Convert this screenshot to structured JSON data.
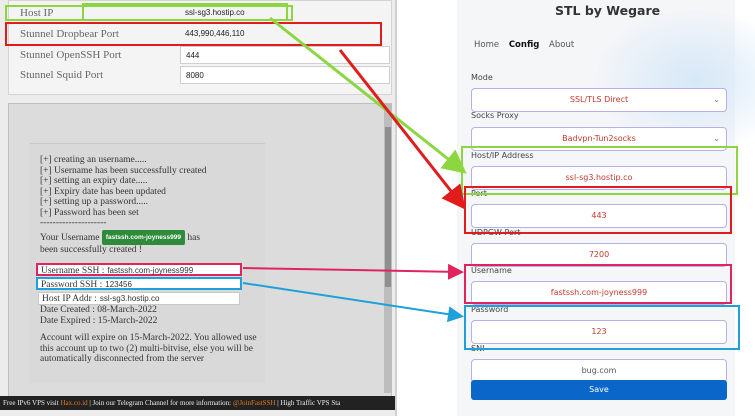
{
  "server_info": {
    "rows": [
      {
        "key": "Host IP",
        "value": "ssl-sg3.hostip.co"
      },
      {
        "key": "Stunnel Dropbear Port",
        "value": "443,990,446,110"
      },
      {
        "key": "Stunnel OpenSSH Port",
        "value": "444"
      },
      {
        "key": "Stunnel Squid Port",
        "value": "8080"
      }
    ]
  },
  "account_log": {
    "lines": [
      "[+] creating an username.....",
      "[+] Username has been successfully created",
      "[+] setting an expiry date.....",
      "[+] Expiry date has been updated",
      "[+] setting up a password.....",
      "[+] Password has been set",
      "---------------------"
    ],
    "username_prefix": "Your Username",
    "username_badge": "fastssh.com-joyness999",
    "username_suffix": "has been successfully created !",
    "username_label": "Username SSH :",
    "username_value": "fastssh.com-joyness999",
    "password_label": "Password SSH :",
    "password_value": "123456",
    "host_label": "Host IP Addr :",
    "host_value": "ssl-sg3.hostip.co",
    "date_created": "Date Created : 08-March-2022",
    "date_expired": "Date Expired : 15-March-2022",
    "note": "Account will expire on 15-March-2022. You allowed use this account up to two (2) multi-bitvise, else you will be automatically disconnected from the server"
  },
  "ticker": {
    "prefix": "Free IPv6 VPS visit",
    "link1": "Hax.co.id",
    "middle": "| Join our Telegram Channel for more information:",
    "link2": "@JoinFastSSH",
    "suffix": "| High Traffic VPS Sta"
  },
  "app": {
    "title": "STL by Wegare",
    "nav": [
      "Home",
      "Config",
      "About"
    ],
    "active_tab": "Config",
    "mode_label": "Mode",
    "mode_value": "SSL/TLS Direct",
    "socks_label": "Socks Proxy",
    "socks_value": "Badvpn-Tun2socks",
    "host_label": "Host/IP Address",
    "host_value": "ssl-sg3.hostip.co",
    "port_label": "Port",
    "port_value": "443",
    "udpgw_label": "UDPGW Port",
    "udpgw_value": "7200",
    "user_label": "Username",
    "user_value": "fastssh.com-joyness999",
    "pass_label": "Password",
    "pass_value": "123",
    "sni_label": "SNI",
    "sni_value": "bug.com",
    "save_label": "Save"
  },
  "colors": {
    "green_highlight": "#8cd642",
    "red_highlight": "#e01c1c",
    "pink_highlight": "#e0245e",
    "blue_highlight": "#1ea0d8",
    "save_button": "#0b66c9"
  }
}
